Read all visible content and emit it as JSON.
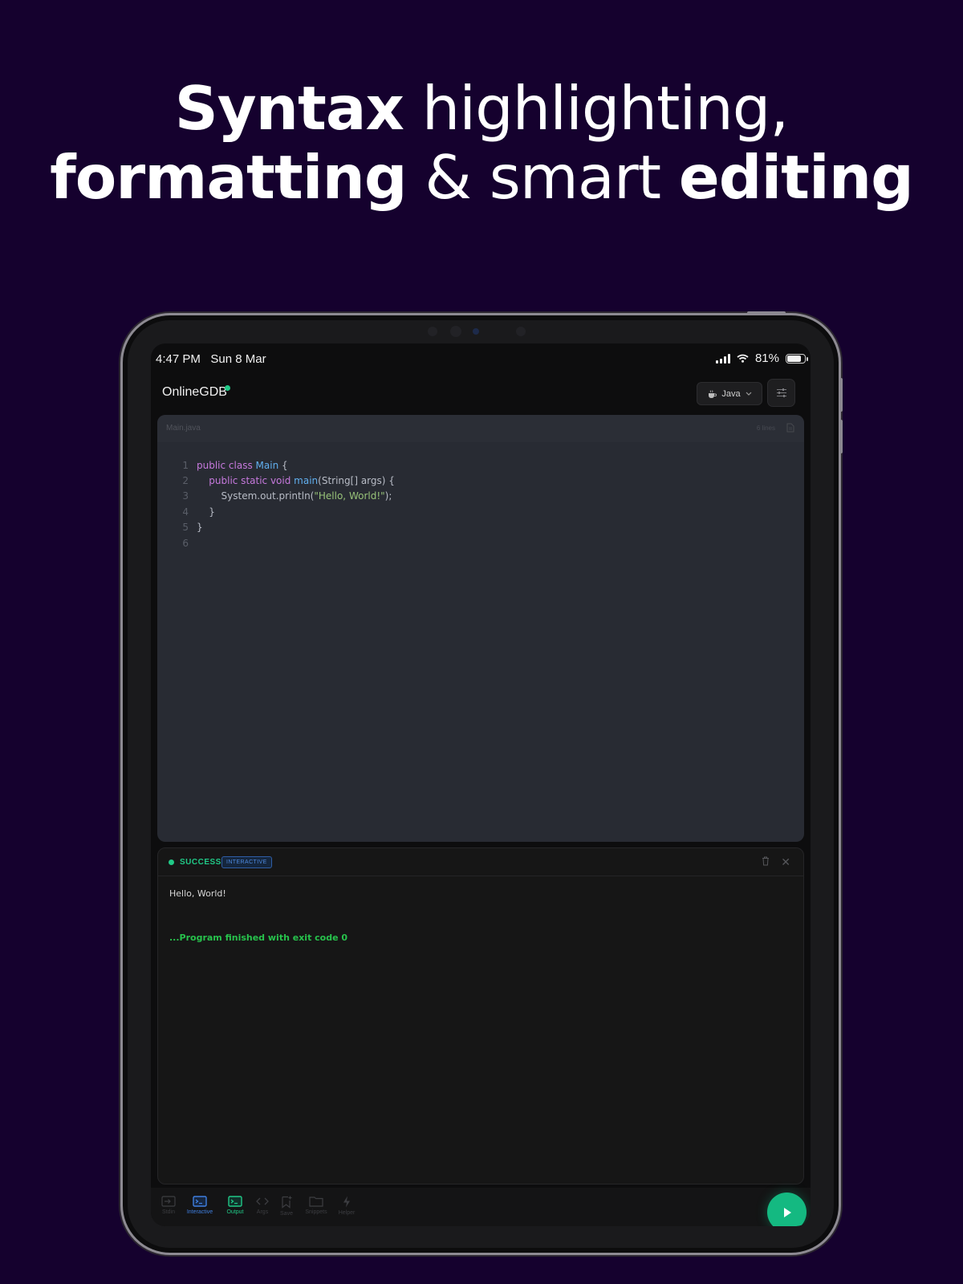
{
  "headline": {
    "line1_bold": "Syntax",
    "line1_regular": "highlighting,",
    "line2_bold": "formatting",
    "line2_regular": "& smart",
    "line2_bold2": "editing"
  },
  "statusbar": {
    "time": "4:47 PM",
    "date": "Sun 8 Mar",
    "battery": "81%",
    "battery_level": 0.81
  },
  "app": {
    "title": "OnlineGDB",
    "language": "Java"
  },
  "editor": {
    "file_name": "Main.java",
    "line_count_label": "6 lines",
    "lines": [
      {
        "num": "1",
        "parts": [
          {
            "t": "public class ",
            "c": "kw"
          },
          {
            "t": "Main",
            "c": "cls"
          },
          {
            "t": " {",
            "c": ""
          }
        ]
      },
      {
        "num": "2",
        "parts": [
          {
            "t": "    ",
            "c": ""
          },
          {
            "t": "public static void ",
            "c": "kw"
          },
          {
            "t": "main",
            "c": "cls"
          },
          {
            "t": "(String[] args) {",
            "c": ""
          }
        ]
      },
      {
        "num": "3",
        "parts": [
          {
            "t": "        System.out.println(",
            "c": ""
          },
          {
            "t": "\"Hello, World!\"",
            "c": "str"
          },
          {
            "t": ");",
            "c": ""
          }
        ]
      },
      {
        "num": "4",
        "parts": [
          {
            "t": "    }",
            "c": ""
          }
        ]
      },
      {
        "num": "5",
        "parts": [
          {
            "t": "}",
            "c": ""
          }
        ]
      },
      {
        "num": "6",
        "parts": []
      }
    ]
  },
  "console": {
    "status": "SUCCESS",
    "mode": "INTERACTIVE",
    "output": "Hello, World!",
    "exit_message": "...Program finished with exit code 0"
  },
  "bottom_tabs": [
    {
      "label": "Stdin",
      "icon": "stdin-icon"
    },
    {
      "label": "Interactive",
      "icon": "terminal-icon"
    },
    {
      "label": "Output",
      "icon": "terminal-icon"
    },
    {
      "label": "Args",
      "icon": "code-icon"
    },
    {
      "label": "Save",
      "icon": "bookmark-icon"
    },
    {
      "label": "Snippets",
      "icon": "folder-icon"
    },
    {
      "label": "Helper",
      "icon": "bolt-icon"
    }
  ],
  "colors": {
    "background": "#15012e",
    "accent_green": "#20c987",
    "accent_blue": "#3f7fe0",
    "editor_bg": "#282b33"
  }
}
